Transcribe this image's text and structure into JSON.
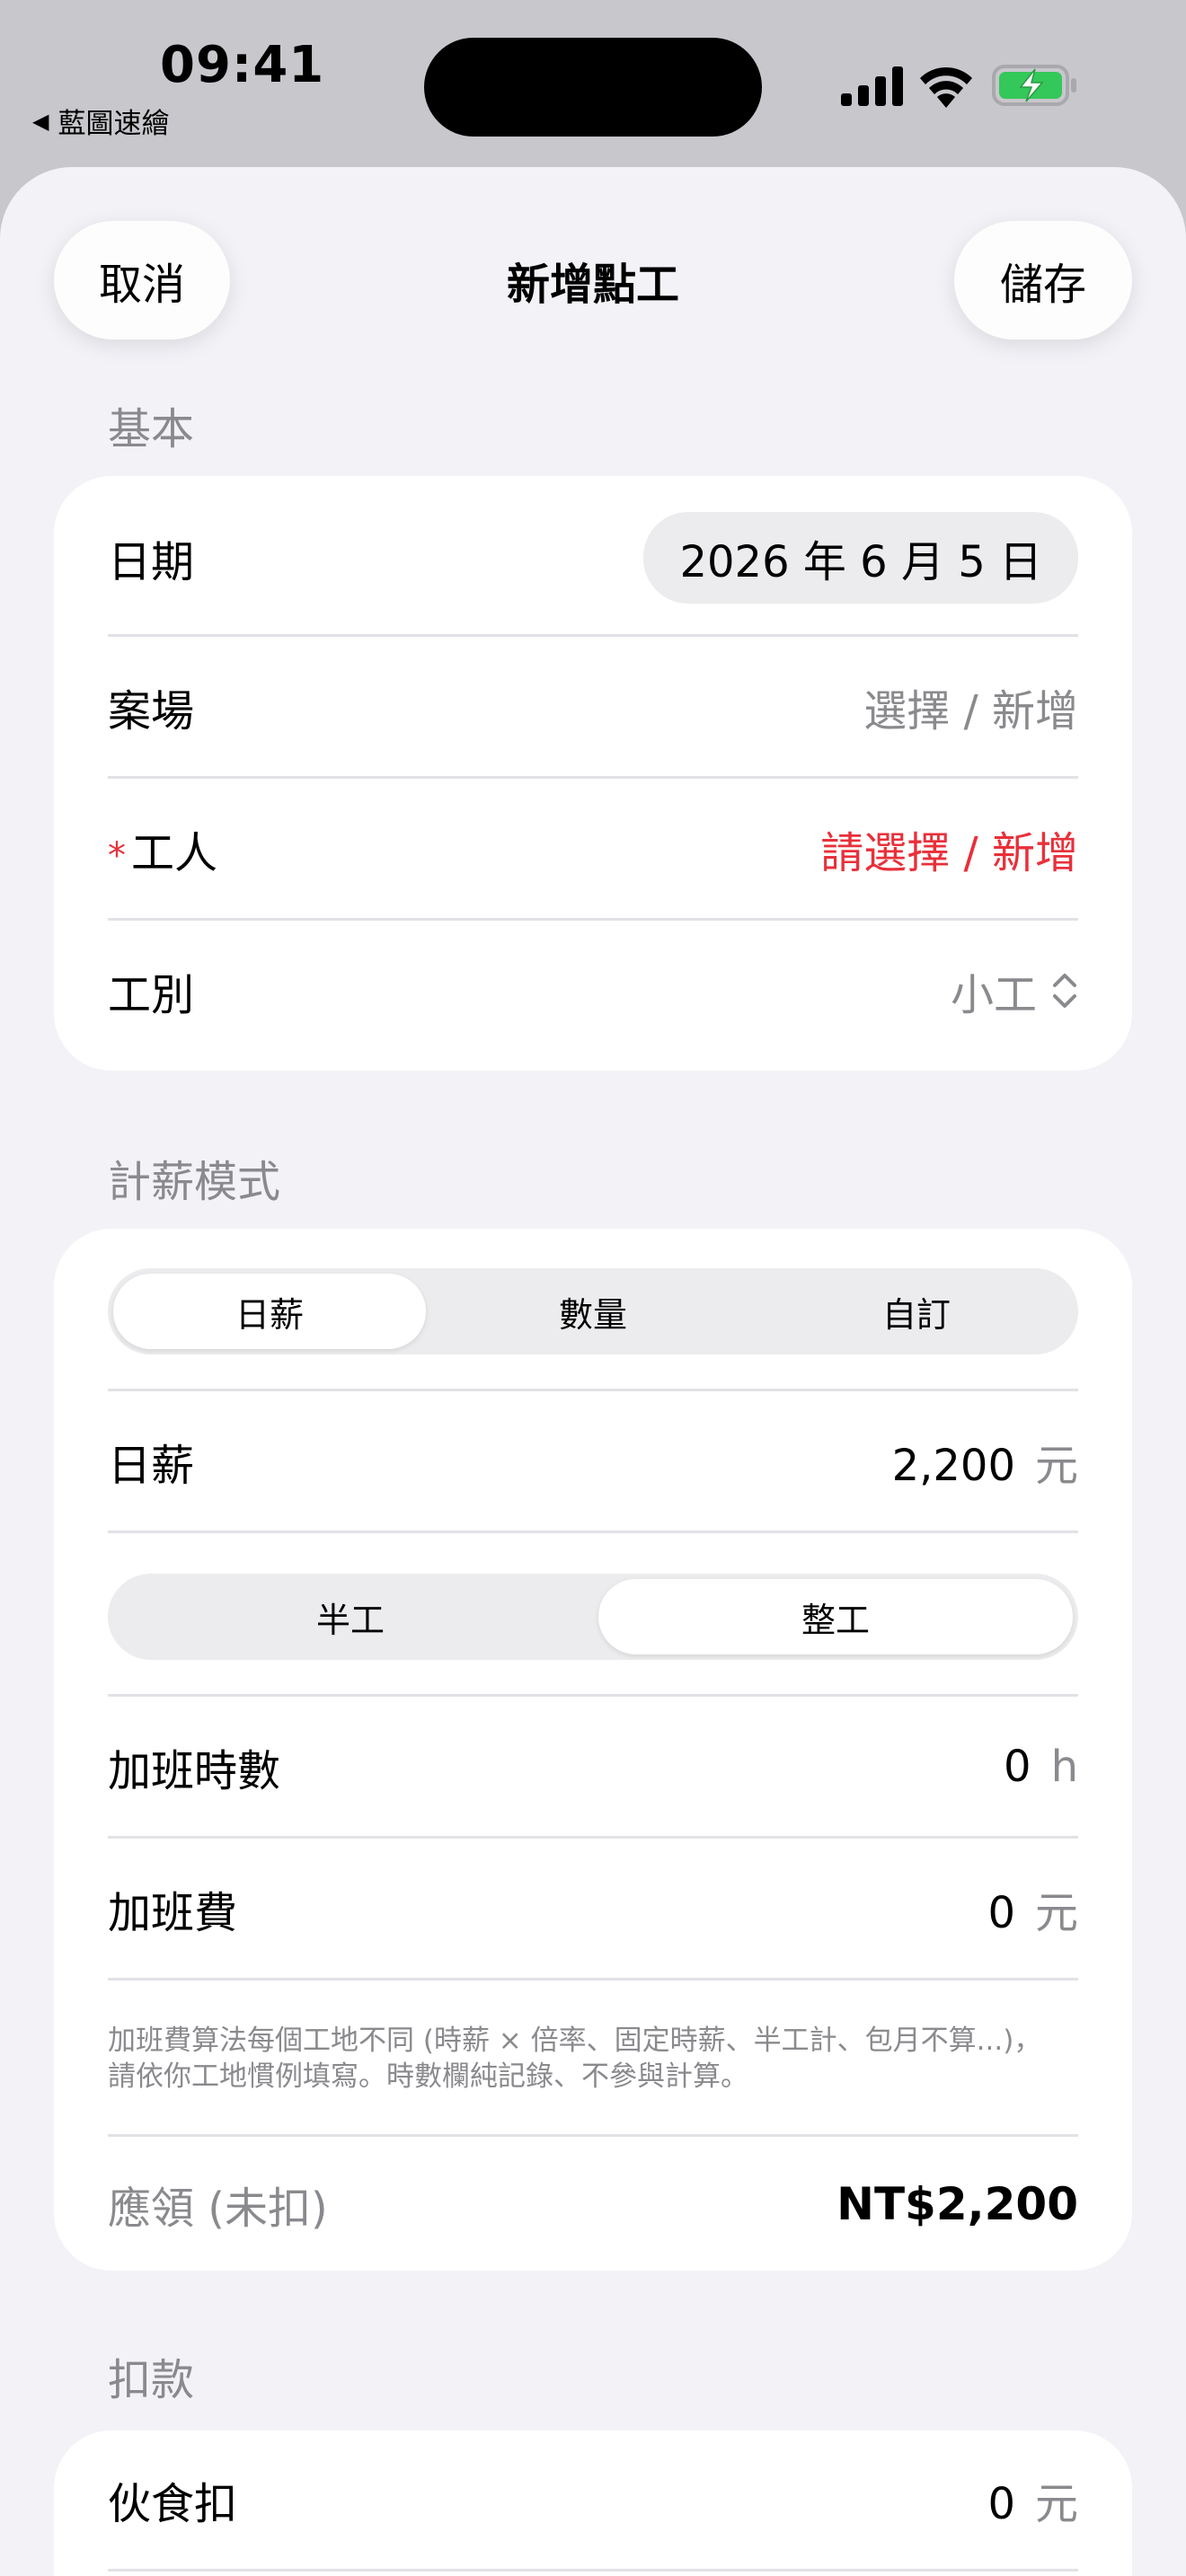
{
  "status_bar": {
    "time": "09:41",
    "back_app": "藍圖速繪",
    "back_icon": "back-triangle-icon",
    "battery_color": "#34c759"
  },
  "nav": {
    "cancel_label": "取消",
    "title": "新增點工",
    "save_label": "儲存"
  },
  "basic": {
    "header": "基本",
    "date_label": "日期",
    "date_value": "2026 年 6 月 5 日",
    "site_label": "案場",
    "site_value": "選擇 / 新增",
    "worker_required_mark": "*",
    "worker_label": "工人",
    "worker_value": "請選擇 / 新增",
    "trade_label": "工別",
    "trade_value": "小工",
    "trade_icon": "chevron-up-down-icon"
  },
  "pay_mode": {
    "header": "計薪模式",
    "modes": [
      "日薪",
      "數量",
      "自訂"
    ],
    "selected_mode": "日薪",
    "daily_label": "日薪",
    "daily_value": "2,200",
    "daily_unit": "元",
    "day_types": [
      "半工",
      "整工"
    ],
    "selected_day_type": "整工",
    "ot_hours_label": "加班時數",
    "ot_hours_value": "0",
    "ot_hours_unit": "h",
    "ot_pay_label": "加班費",
    "ot_pay_value": "0",
    "ot_pay_unit": "元",
    "note_line1": "加班費算法每個工地不同 (時薪 × 倍率、固定時薪、半工計、包月不算...)，",
    "note_line2": "請依你工地慣例填寫。時數欄純記錄、不參與計算。",
    "total_label": "應領 (未扣)",
    "total_value": "NT$2,200"
  },
  "deductions": {
    "header": "扣款",
    "meal_label": "伙食扣",
    "meal_value": "0",
    "meal_unit": "元"
  }
}
